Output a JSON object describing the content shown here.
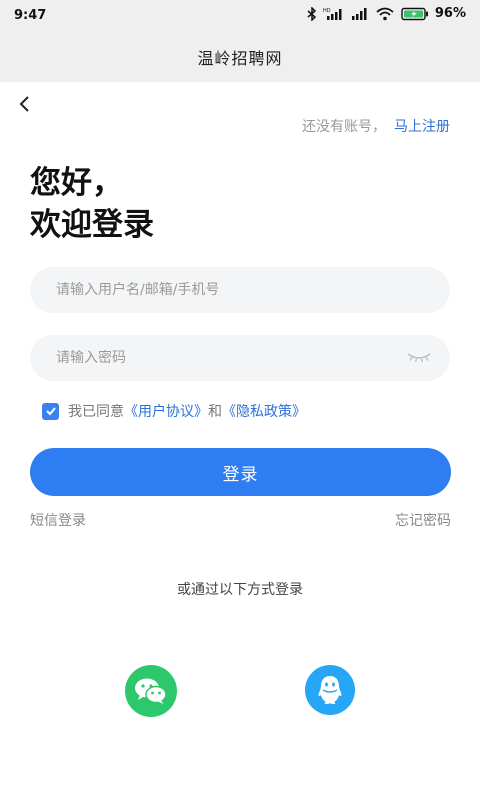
{
  "status_bar": {
    "time": "9:47",
    "battery_percent": "96%",
    "icons": [
      "bluetooth-icon",
      "hd-signal-icon",
      "signal-icon",
      "wifi-icon",
      "battery-icon"
    ]
  },
  "app_bar": {
    "title": "温岭招聘网"
  },
  "register": {
    "hint": "还没有账号，",
    "link": "马上注册"
  },
  "greeting": {
    "line1": "您好，",
    "line2": "欢迎登录"
  },
  "form": {
    "username_placeholder": "请输入用户名/邮箱/手机号",
    "password_placeholder": "请输入密码"
  },
  "agreement": {
    "prefix": "我已同意",
    "user_agreement": "《用户协议》",
    "and": "和",
    "privacy_policy": "《隐私政策》",
    "checked": true
  },
  "login_button": "登录",
  "links": {
    "sms_login": "短信登录",
    "forgot_password": "忘记密码"
  },
  "other_login": {
    "title": "或通过以下方式登录",
    "methods": [
      "wechat-icon",
      "qq-icon"
    ]
  },
  "colors": {
    "accent": "#2f7df2",
    "link": "#2f6fd8",
    "wechat": "#2dc86b",
    "qq": "#27a6f5"
  }
}
